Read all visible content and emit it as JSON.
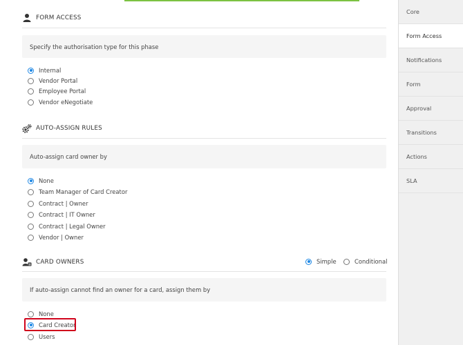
{
  "form_access": {
    "title": "FORM ACCESS",
    "instruction": "Specify the authorisation type for this phase",
    "options": [
      "Internal",
      "Vendor Portal",
      "Employee Portal",
      "Vendor eNegotiate"
    ],
    "selected": "Internal"
  },
  "auto_assign": {
    "title": "AUTO-ASSIGN RULES",
    "instruction": "Auto-assign card owner by",
    "options": [
      "None",
      "Team Manager of Card Creator",
      "Contract | Owner",
      "Contract | IT Owner",
      "Contract | Legal Owner",
      "Vendor | Owner"
    ],
    "selected": "None"
  },
  "card_owners": {
    "title": "CARD OWNERS",
    "mode_options": [
      "Simple",
      "Conditional"
    ],
    "mode_selected": "Simple",
    "instruction": "If auto-assign cannot find an owner for a card, assign them by",
    "options": [
      "None",
      "Card Creator",
      "Users"
    ],
    "selected": "Card Creator"
  },
  "sidebar": {
    "tabs": [
      "Core",
      "Form Access",
      "Notifications",
      "Form",
      "Approval",
      "Transitions",
      "Actions",
      "SLA"
    ],
    "active": "Form Access"
  },
  "colors": {
    "accent": "#1e88e5",
    "highlight": "#d0021b",
    "top_bar": "#7cc242"
  },
  "icons": {
    "form_access": "user-icon",
    "auto_assign": "gears-icon",
    "card_owners": "user-card-icon"
  }
}
